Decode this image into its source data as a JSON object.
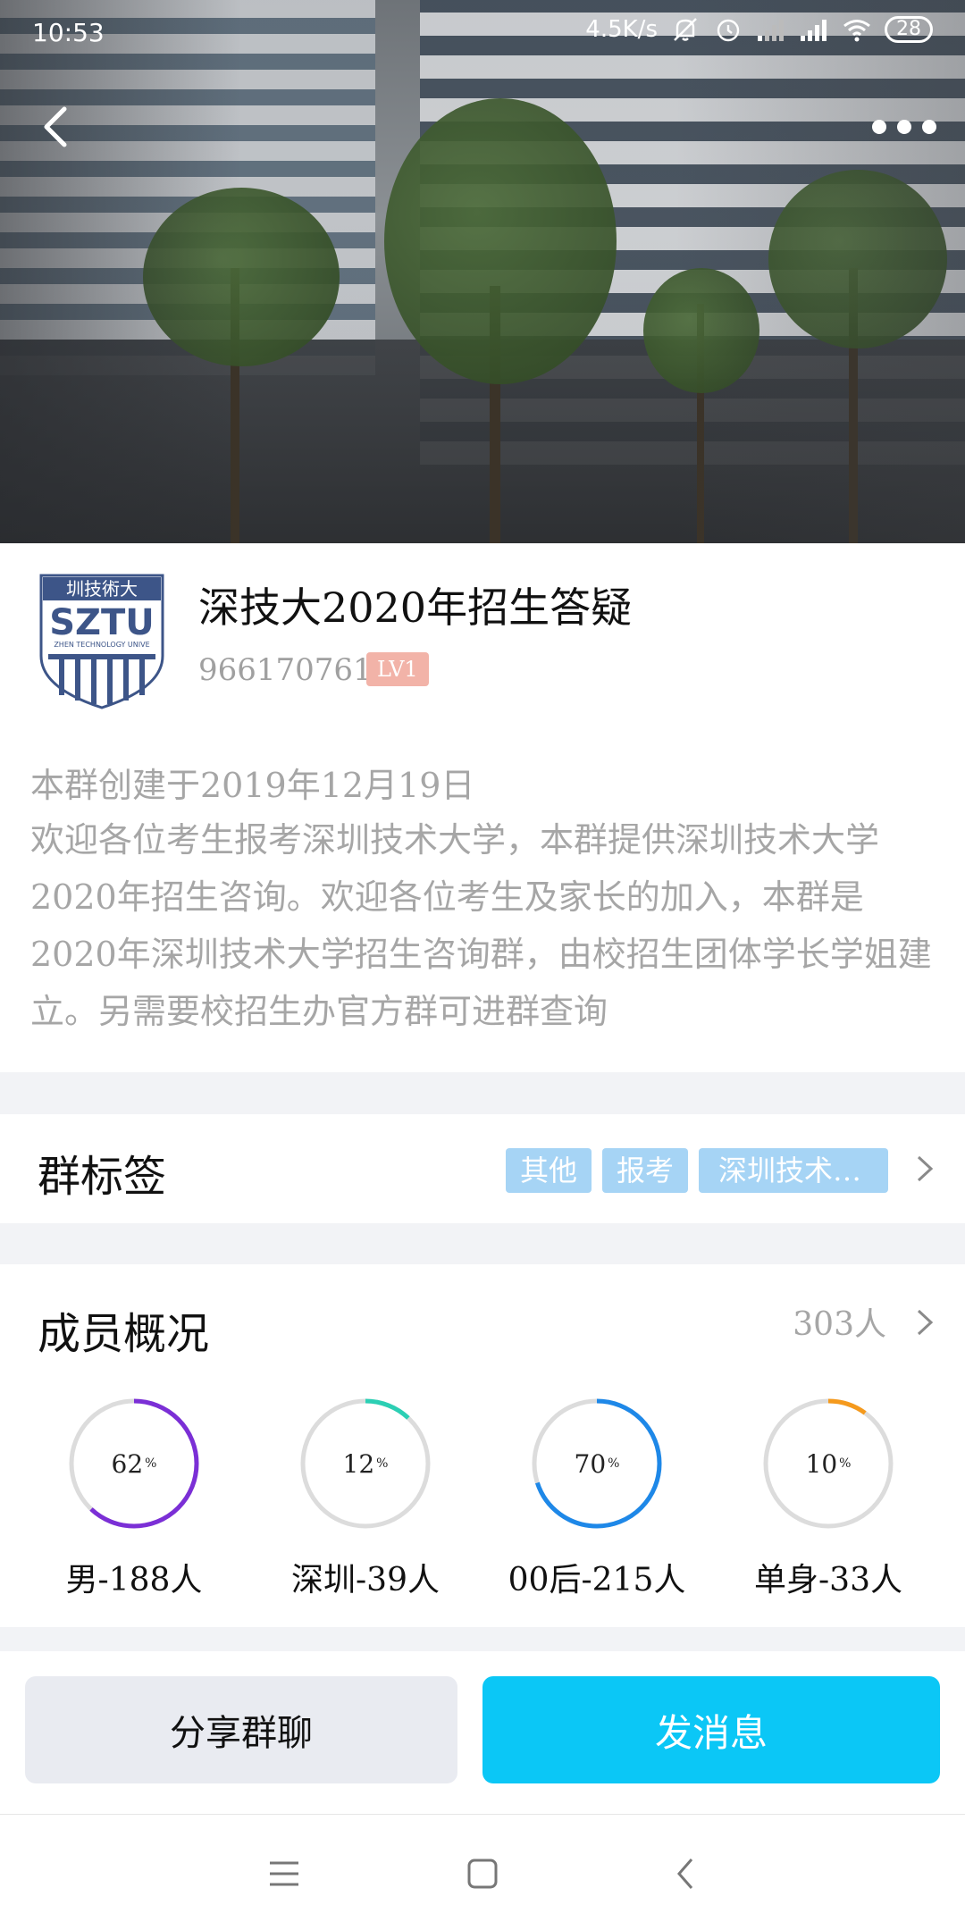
{
  "status_bar": {
    "time": "10:53",
    "net_speed": "4.5K/s",
    "battery": "28",
    "icons": [
      "mute-bell-icon",
      "alarm-icon",
      "signal-icon",
      "hd-signal-icon",
      "wifi-icon",
      "battery-icon"
    ]
  },
  "header": {
    "back_icon": "chevron-left-icon",
    "more_icon": "more-dots-icon"
  },
  "group": {
    "name": "深技大2020年招生答疑",
    "id": "966170761",
    "level": "LV1",
    "avatar_text": "SZTU",
    "avatar_top": "圳技術大",
    "avatar_sub": "ZHEN TECHNOLOGY UNIVE",
    "created": "本群创建于2019年12月19日",
    "description": "欢迎各位考生报考深圳技术大学，本群提供深圳技术大学2020年招生咨询。欢迎各位考生及家长的加入，本群是2020年深圳技术大学招生咨询群，由校招生团体学长学姐建立。另需要校招生办官方群可进群查询"
  },
  "tags": {
    "title": "群标签",
    "items": [
      "其他",
      "报考",
      "深圳技术…"
    ]
  },
  "members": {
    "title": "成员概况",
    "count": "303人",
    "stats": [
      {
        "percent": "62",
        "unit": "%",
        "label": "男-188人",
        "value": 0.62,
        "color": "#7b2fd6"
      },
      {
        "percent": "12",
        "unit": "%",
        "label": "深圳-39人",
        "value": 0.12,
        "color": "#2ccfb4"
      },
      {
        "percent": "70",
        "unit": "%",
        "label": "00后-215人",
        "value": 0.7,
        "color": "#1e88e8"
      },
      {
        "percent": "10",
        "unit": "%",
        "label": "单身-33人",
        "value": 0.1,
        "color": "#f59a1d"
      }
    ]
  },
  "actions": {
    "share": "分享群聊",
    "send": "发消息"
  },
  "navbar": {
    "icons": [
      "menu-icon",
      "home-square-icon",
      "back-triangle-icon"
    ]
  }
}
